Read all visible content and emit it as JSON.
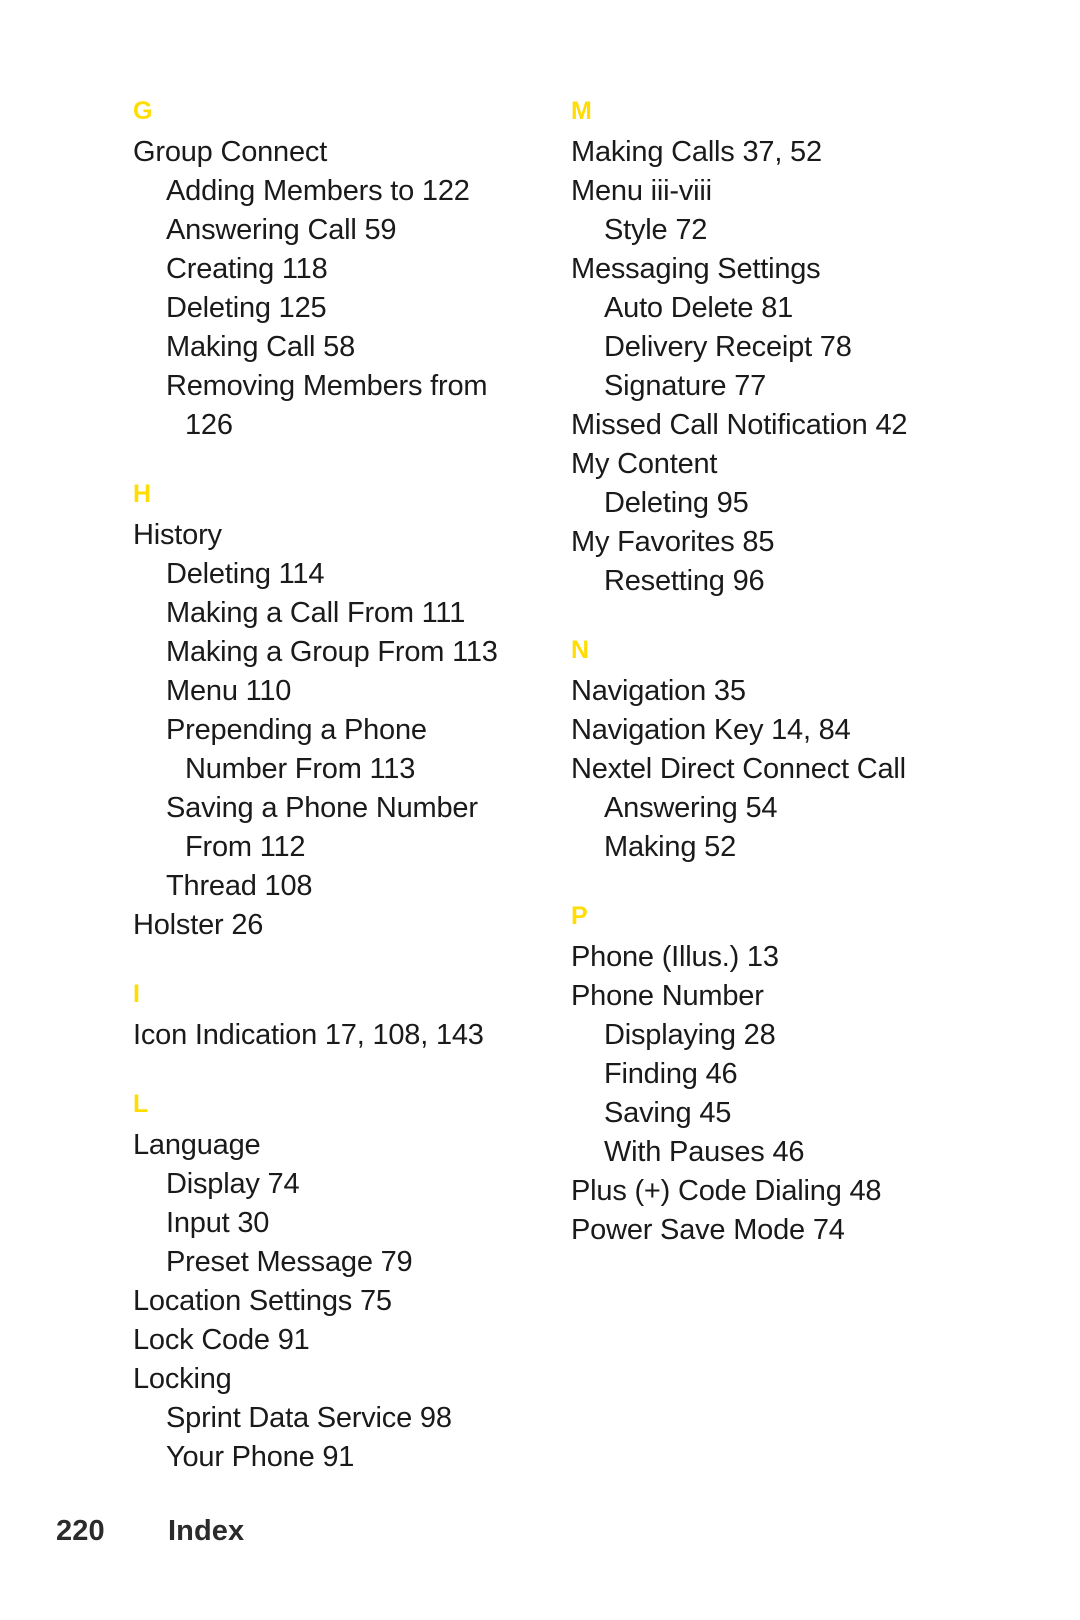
{
  "document": {
    "type": "index-page",
    "page_number": "220",
    "footer_label": "Index",
    "accent_color": "#FFDD00",
    "text_color": "#1a1a1a"
  },
  "columns": [
    {
      "name": "left-column",
      "sections": [
        {
          "letter": "G",
          "entries": [
            {
              "level": 0,
              "text": "Group Connect"
            },
            {
              "level": 1,
              "text": "Adding Members to 122"
            },
            {
              "level": 1,
              "text": "Answering Call 59"
            },
            {
              "level": 1,
              "text": "Creating 118"
            },
            {
              "level": 1,
              "text": "Deleting 125"
            },
            {
              "level": 1,
              "text": "Making Call 58"
            },
            {
              "level": 1,
              "text": "Removing Members from"
            },
            {
              "level": 2,
              "text": "126"
            }
          ]
        },
        {
          "letter": "H",
          "entries": [
            {
              "level": 0,
              "text": "History"
            },
            {
              "level": 1,
              "text": "Deleting 114"
            },
            {
              "level": 1,
              "text": "Making a Call From 111"
            },
            {
              "level": 1,
              "text": "Making a Group From 113"
            },
            {
              "level": 1,
              "text": "Menu 110"
            },
            {
              "level": 1,
              "text": "Prepending a Phone"
            },
            {
              "level": 2,
              "text": "Number From 113"
            },
            {
              "level": 1,
              "text": "Saving a Phone Number"
            },
            {
              "level": 2,
              "text": "From 112"
            },
            {
              "level": 1,
              "text": "Thread 108"
            },
            {
              "level": 0,
              "text": "Holster 26"
            }
          ]
        },
        {
          "letter": "I",
          "entries": [
            {
              "level": 0,
              "text": "Icon Indication 17, 108, 143"
            }
          ]
        },
        {
          "letter": "L",
          "entries": [
            {
              "level": 0,
              "text": "Language"
            },
            {
              "level": 1,
              "text": "Display 74"
            },
            {
              "level": 1,
              "text": "Input 30"
            },
            {
              "level": 1,
              "text": "Preset Message 79"
            },
            {
              "level": 0,
              "text": "Location Settings 75"
            },
            {
              "level": 0,
              "text": "Lock Code 91"
            },
            {
              "level": 0,
              "text": "Locking"
            },
            {
              "level": 1,
              "text": "Sprint Data Service 98"
            },
            {
              "level": 1,
              "text": "Your Phone 91"
            }
          ]
        }
      ]
    },
    {
      "name": "right-column",
      "sections": [
        {
          "letter": "M",
          "entries": [
            {
              "level": 0,
              "text": "Making Calls 37, 52"
            },
            {
              "level": 0,
              "text": "Menu iii-viii"
            },
            {
              "level": 1,
              "text": "Style 72"
            },
            {
              "level": 0,
              "text": "Messaging Settings"
            },
            {
              "level": 1,
              "text": "Auto Delete 81"
            },
            {
              "level": 1,
              "text": "Delivery Receipt 78"
            },
            {
              "level": 1,
              "text": "Signature 77"
            },
            {
              "level": 0,
              "text": "Missed Call Notification 42"
            },
            {
              "level": 0,
              "text": "My Content"
            },
            {
              "level": 1,
              "text": "Deleting 95"
            },
            {
              "level": 0,
              "text": "My Favorites 85"
            },
            {
              "level": 1,
              "text": "Resetting 96"
            }
          ]
        },
        {
          "letter": "N",
          "entries": [
            {
              "level": 0,
              "text": "Navigation 35"
            },
            {
              "level": 0,
              "text": "Navigation Key 14, 84"
            },
            {
              "level": 0,
              "text": "Nextel Direct Connect Call"
            },
            {
              "level": 1,
              "text": "Answering 54"
            },
            {
              "level": 1,
              "text": "Making 52"
            }
          ]
        },
        {
          "letter": "P",
          "entries": [
            {
              "level": 0,
              "text": "Phone (Illus.) 13"
            },
            {
              "level": 0,
              "text": "Phone Number"
            },
            {
              "level": 1,
              "text": "Displaying 28"
            },
            {
              "level": 1,
              "text": "Finding 46"
            },
            {
              "level": 1,
              "text": "Saving  45"
            },
            {
              "level": 1,
              "text": "With Pauses 46"
            },
            {
              "level": 0,
              "text": "Plus (+) Code Dialing 48"
            },
            {
              "level": 0,
              "text": "Power Save Mode 74"
            }
          ]
        }
      ]
    }
  ]
}
